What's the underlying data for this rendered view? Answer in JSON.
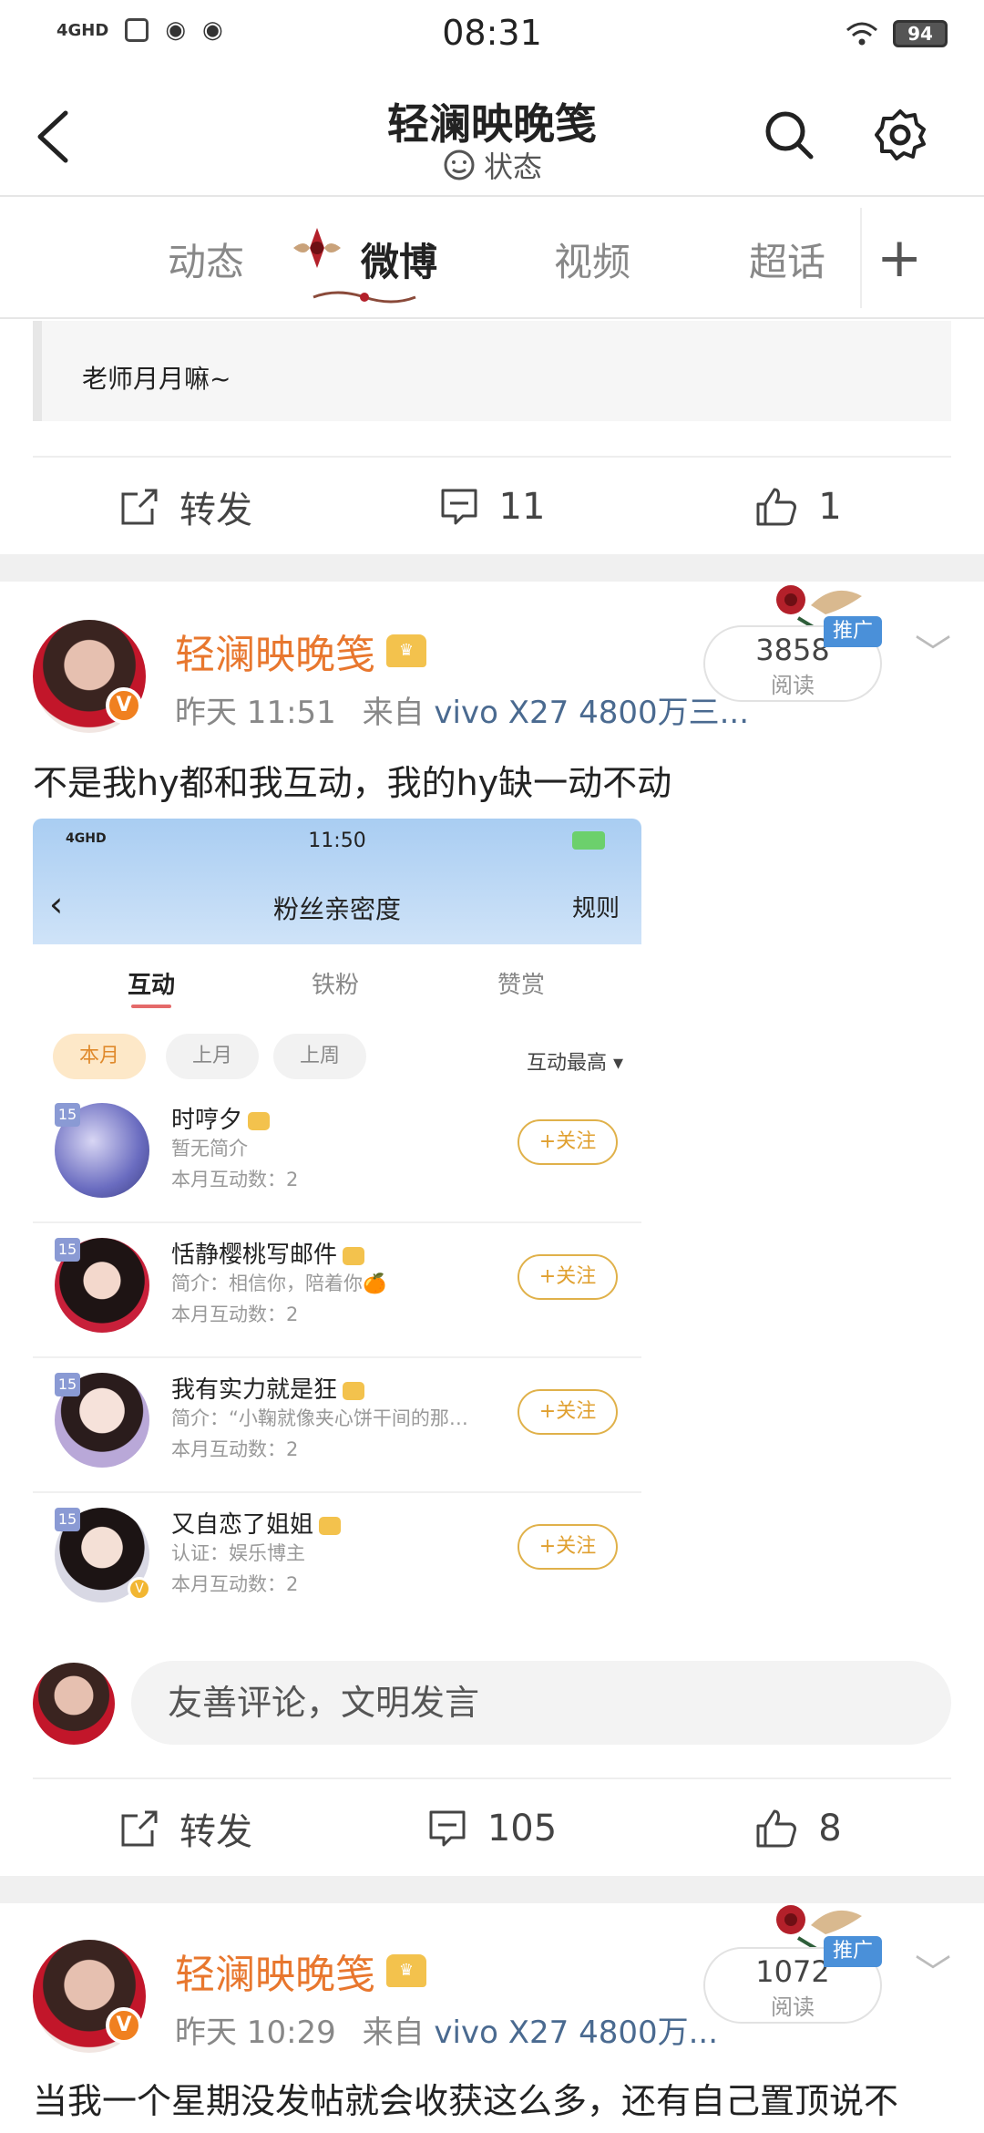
{
  "status_bar": {
    "time": "08:31",
    "network": "4GHD",
    "battery": "94"
  },
  "header": {
    "title": "轻澜映晚笺",
    "subtitle": "状态"
  },
  "tabs": [
    {
      "label": "动态",
      "active": false
    },
    {
      "label": "微博",
      "active": true
    },
    {
      "label": "视频",
      "active": false
    },
    {
      "label": "超话",
      "active": false
    }
  ],
  "tab_add": "+",
  "prev_post": {
    "quote_text": "老师月月嘛~",
    "actions": {
      "repost": "转发",
      "comments": "11",
      "likes": "1"
    }
  },
  "post1": {
    "username": "轻澜映晚笺",
    "time": "昨天 11:51",
    "from_label": "来自",
    "source": "vivo X27 4800万三...",
    "reads": "3858",
    "reads_label": "阅读",
    "promo": "推广",
    "text": "不是我hy都和我互动，我的hy缺一动不动",
    "screenshot": {
      "time": "11:50",
      "title": "粉丝亲密度",
      "rules": "规则",
      "tabs": [
        "互动",
        "铁粉",
        "赞赏"
      ],
      "chips": [
        "本月",
        "上月",
        "上周"
      ],
      "sort": "互动最高",
      "follow_label": "+关注",
      "rows": [
        {
          "level": "15",
          "name": "时哼夕",
          "bio": "暂无简介",
          "count": "本月互动数：2"
        },
        {
          "level": "15",
          "name": "恬静樱桃写邮件",
          "bio": "简介：相信你，陪着你🍊",
          "count": "本月互动数：2"
        },
        {
          "level": "15",
          "name": "我有实力就是狂",
          "bio": "简介：“小鞠就像夹心饼干间的那…",
          "count": "本月互动数：2"
        },
        {
          "level": "15",
          "name": "又自恋了姐姐",
          "bio": "认证：娱乐博主",
          "count": "本月互动数：2"
        }
      ]
    },
    "comment_placeholder": "友善评论，文明发言",
    "actions": {
      "repost": "转发",
      "comments": "105",
      "likes": "8"
    }
  },
  "post2": {
    "username": "轻澜映晚笺",
    "time": "昨天 10:29",
    "from_label": "来自",
    "source": "vivo X27 4800万...",
    "reads": "1072",
    "reads_label": "阅读",
    "promo": "推广",
    "text": "当我一个星期没发帖就会收获这么多，还有自己置顶说不"
  },
  "colors": {
    "accent": "#e8772e",
    "link": "#4a6a90",
    "promo": "#4a90d9"
  }
}
